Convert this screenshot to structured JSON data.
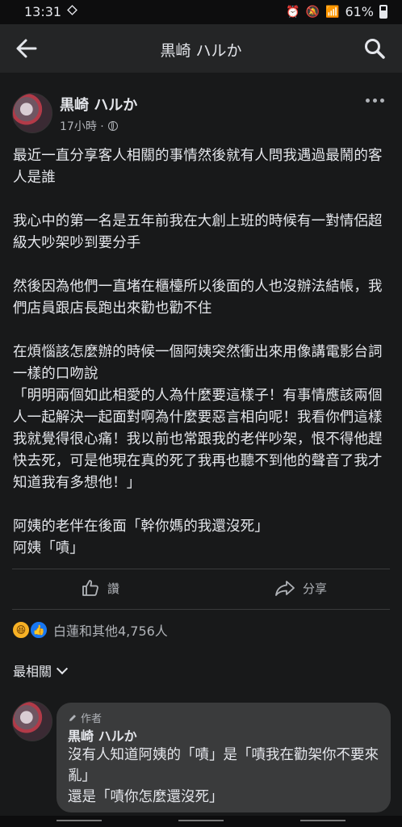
{
  "status": {
    "time": "13:31",
    "battery": "61%"
  },
  "appbar": {
    "title": "黒崎 ハルか"
  },
  "post": {
    "author": "黒崎 ハルか",
    "time": "17小時 ·",
    "text": "最近一直分享客人相關的事情然後就有人問我遇過最鬧的客人是誰\n\n我心中的第一名是五年前我在大創上班的時候有一對情侶超級大吵架吵到要分手\n\n然後因為他們一直堵在櫃檯所以後面的人也沒辦法結帳，我們店員跟店長跑出來勸也勸不住\n\n在煩惱該怎麼辦的時候一個阿姨突然衝出來用像講電影台詞一樣的口吻說\n「明明兩個如此相愛的人為什麼要這樣子！有事情應該兩個人一起解決一起面對啊為什麼要惡言相向呢！我看你們這樣我就覺得很心痛！我以前也常跟我的老伴吵架，恨不得他趕快去死，可是他現在真的死了我再也聽不到他的聲音了我才知道我有多想他！」\n\n阿姨的老伴在後面「幹你媽的我還沒死」\n阿姨「嘖」"
  },
  "actions": {
    "like": "讚",
    "share": "分享"
  },
  "reactions": {
    "summary": "白蓮和其他4,756人"
  },
  "sort": {
    "label": "最相關"
  },
  "comment": {
    "badge": "作者",
    "author": "黒崎 ハルか",
    "text": "沒有人知道阿姨的「嘖」是「嘖我在勸架你不要來亂」\n還是「嘖你怎麼還沒死」"
  },
  "colors": {
    "background": "#18191a",
    "bubble": "#3a3b3c",
    "text": "#e4e6eb",
    "secondary": "#b0b3b8"
  }
}
